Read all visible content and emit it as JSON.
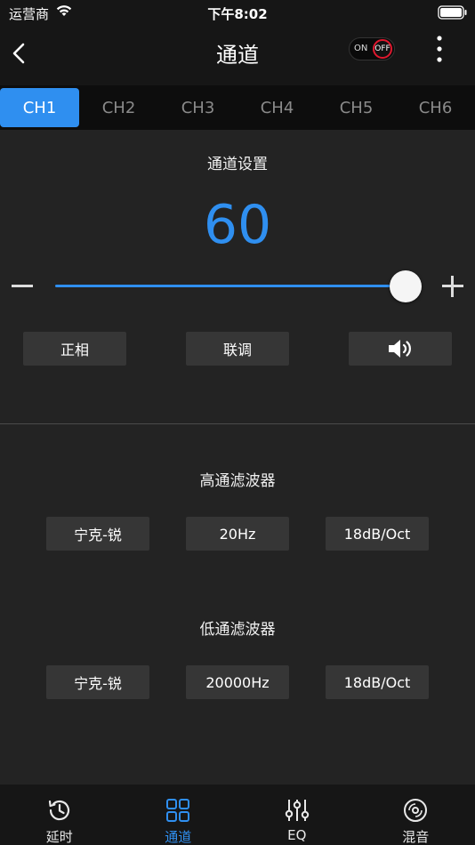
{
  "status_bar": {
    "carrier": "运营商",
    "time": "下午8:02"
  },
  "nav": {
    "title": "通道",
    "toggle_on_label": "ON",
    "toggle_off_label": "OFF"
  },
  "channels": [
    "CH1",
    "CH2",
    "CH3",
    "CH4",
    "CH5",
    "CH6"
  ],
  "active_channel": 0,
  "channel_settings": {
    "title": "通道设置",
    "value": "60",
    "slider_level": 0.98,
    "phase_button": "正相",
    "link_button": "联调"
  },
  "high_pass": {
    "title": "高通滤波器",
    "type": "宁克-锐",
    "frequency": "20Hz",
    "slope": "18dB/Oct"
  },
  "low_pass": {
    "title": "低通滤波器",
    "type": "宁克-锐",
    "frequency": "20000Hz",
    "slope": "18dB/Oct"
  },
  "tabs": [
    {
      "label": "延时",
      "icon": "clock-history-icon"
    },
    {
      "label": "通道",
      "icon": "grid-icon"
    },
    {
      "label": "EQ",
      "icon": "sliders-icon"
    },
    {
      "label": "混音",
      "icon": "disc-icon"
    }
  ],
  "active_tab": 1,
  "colors": {
    "accent": "#2f8ff0",
    "off_red": "#e0182e",
    "background": "#232323"
  }
}
